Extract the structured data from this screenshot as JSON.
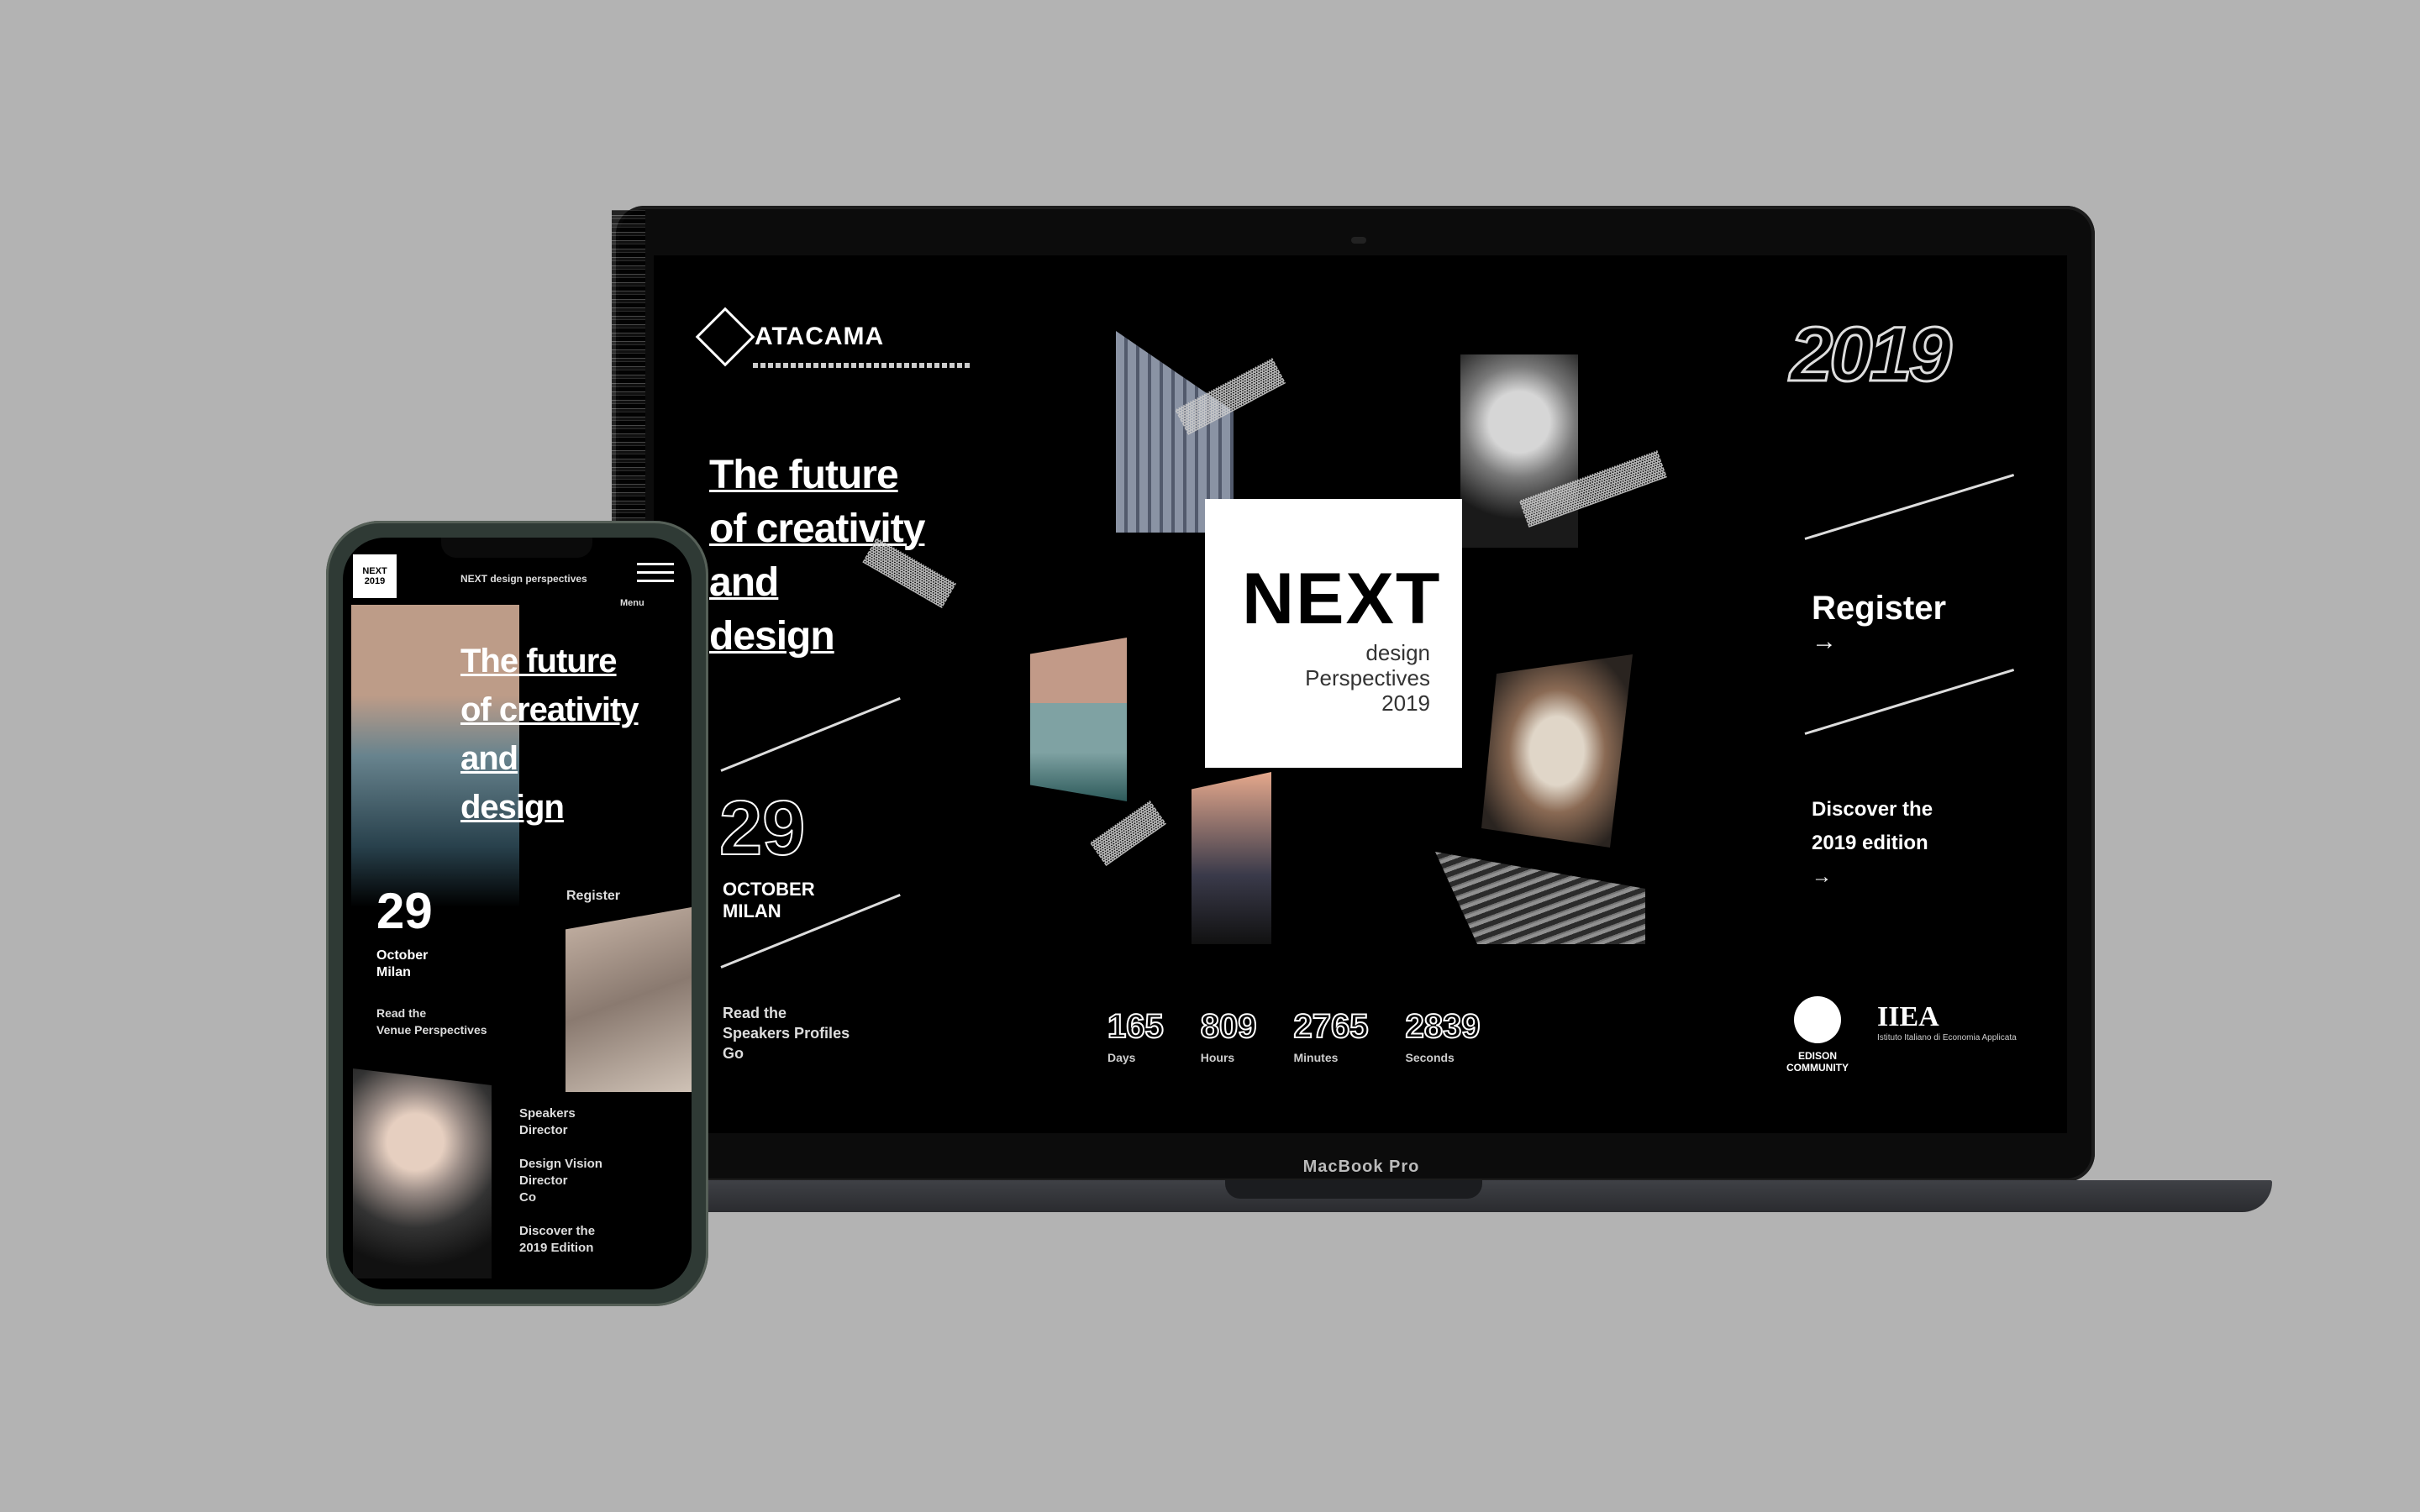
{
  "laptop": {
    "brand": "MacBook Pro"
  },
  "desktop_site": {
    "logo_text": "ATACAMA",
    "headline": [
      "The future",
      "of creativity",
      "and",
      "design"
    ],
    "date_number": "29",
    "date_text": [
      "OCTOBER",
      "MILAN"
    ],
    "news": [
      "Read the",
      "Speakers Profiles",
      "Go"
    ],
    "year": "2019",
    "register_label": "Register",
    "arrow": "→",
    "discover": [
      "Discover the",
      "2019 edition",
      "→"
    ],
    "next_title": "NEXT",
    "next_subtitle": [
      "design",
      "Perspectives",
      "2019"
    ],
    "stats": [
      {
        "value": "165",
        "label": "Days"
      },
      {
        "value": "809",
        "label": "Hours"
      },
      {
        "value": "2765",
        "label": "Minutes"
      },
      {
        "value": "2839",
        "label": "Seconds"
      }
    ],
    "partner1": "EDISON COMMUNITY",
    "partner2_title": "IIEA",
    "partner2_sub": "Istituto Italiano di Economia Applicata"
  },
  "mobile_site": {
    "logo_text": "NEXT 2019",
    "title_bar": "NEXT design perspectives",
    "menu_label": "Menu",
    "headline": [
      "The future",
      "of creativity",
      "and",
      "design"
    ],
    "date_number": "29",
    "date_text": [
      "October",
      "Milan"
    ],
    "agenda": [
      "Read the",
      "Venue Perspectives"
    ],
    "register_label": "Register",
    "speakers": [
      "Speakers",
      "Director",
      "",
      "Design Vision",
      "Director",
      "Co",
      "",
      "Discover the",
      "2019 Edition"
    ]
  }
}
